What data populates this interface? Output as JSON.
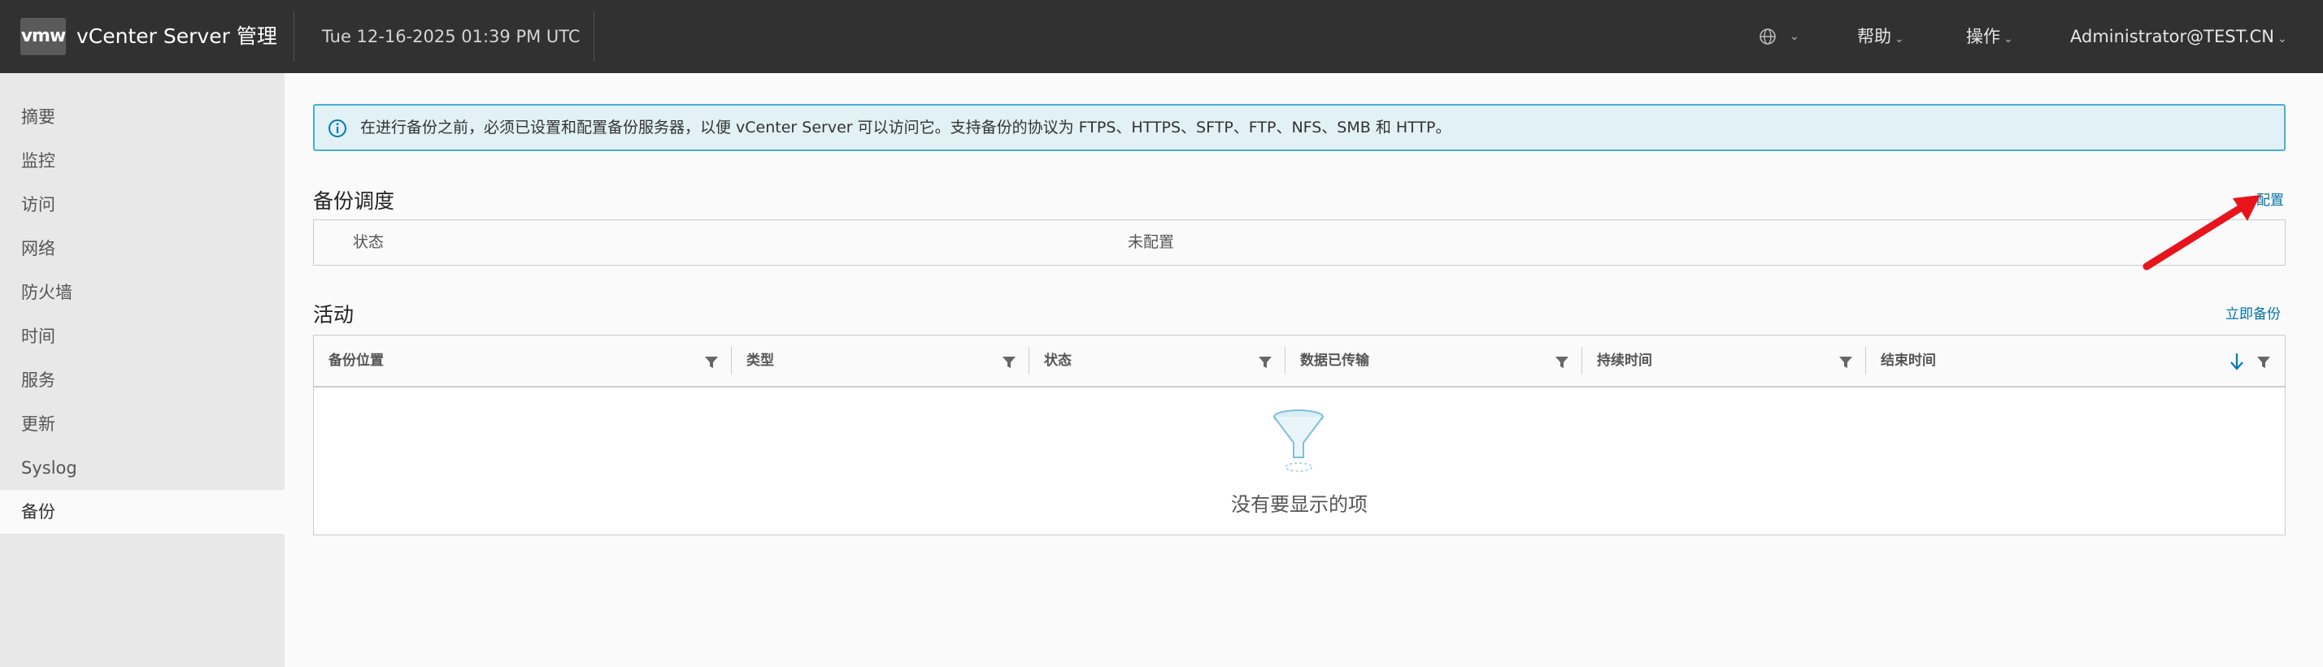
{
  "header": {
    "logo": "vmw",
    "title": "vCenter Server 管理",
    "datetime": "Tue 12-16-2025 01:39 PM UTC",
    "language_icon": "globe-icon",
    "help_label": "帮助",
    "actions_label": "操作",
    "user_label": "Administrator@TEST.CN"
  },
  "sidebar": {
    "items": [
      {
        "label": "摘要"
      },
      {
        "label": "监控"
      },
      {
        "label": "访问"
      },
      {
        "label": "网络"
      },
      {
        "label": "防火墙"
      },
      {
        "label": "时间"
      },
      {
        "label": "服务"
      },
      {
        "label": "更新"
      },
      {
        "label": "Syslog"
      },
      {
        "label": "备份",
        "active": true
      }
    ]
  },
  "alert": {
    "icon": "info-icon",
    "text": "在进行备份之前，必须已设置和配置备份服务器，以便 vCenter Server 可以访问它。支持备份的协议为 FTPS、HTTPS、SFTP、FTP、NFS、SMB 和 HTTP。"
  },
  "schedule": {
    "title": "备份调度",
    "configure_link": "配置",
    "status_label": "状态",
    "status_value": "未配置"
  },
  "activity": {
    "title": "活动",
    "backup_now_link": "立即备份",
    "columns": [
      "备份位置",
      "类型",
      "状态",
      "数据已传输",
      "持续时间",
      "结束时间"
    ],
    "empty_text": "没有要显示的项"
  },
  "colors": {
    "header_bg": "#313131",
    "sidebar_bg": "#e8e8e8",
    "link": "#0072a3",
    "alert_bg": "#e1f1f6",
    "alert_border": "#49afd9",
    "annotation_arrow": "#e8141c"
  }
}
